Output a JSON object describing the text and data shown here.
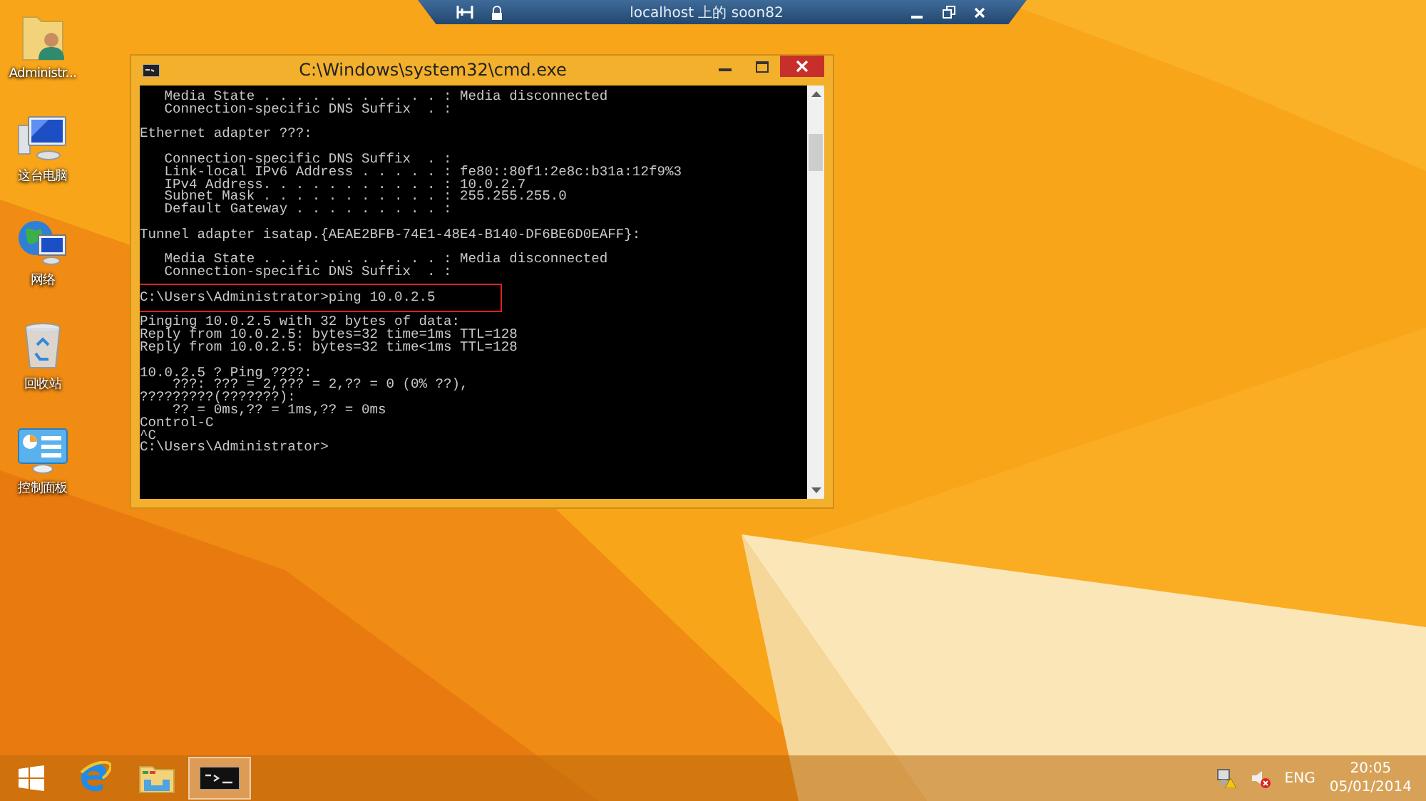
{
  "remote_bar": {
    "title": "localhost 上的 soon82"
  },
  "desktop_icons": [
    {
      "label": "Administr...",
      "kind": "user-folder"
    },
    {
      "label": "这台电脑",
      "kind": "computer"
    },
    {
      "label": "网络",
      "kind": "network"
    },
    {
      "label": "回收站",
      "kind": "recycle-bin"
    },
    {
      "label": "控制面板",
      "kind": "control-panel"
    }
  ],
  "console": {
    "title": "C:\\Windows\\system32\\cmd.exe",
    "blocks": [
      {
        "highlighted": false,
        "lines": [
          "   Media State . . . . . . . . . . . : Media disconnected",
          "   Connection-specific DNS Suffix  . :"
        ]
      },
      {
        "highlighted": false,
        "lines": [
          "Ethernet adapter ???:"
        ]
      },
      {
        "highlighted": false,
        "lines": [
          "   Connection-specific DNS Suffix  . :",
          "   Link-local IPv6 Address . . . . . : fe80::80f1:2e8c:b31a:12f9%3",
          "   IPv4 Address. . . . . . . . . . . : 10.0.2.7",
          "   Subnet Mask . . . . . . . . . . . : 255.255.255.0",
          "   Default Gateway . . . . . . . . . :"
        ]
      },
      {
        "highlighted": false,
        "lines": [
          "Tunnel adapter isatap.{AEAE2BFB-74E1-48E4-B140-DF6BE6D0EAFF}:"
        ]
      },
      {
        "highlighted": false,
        "lines": [
          "   Media State . . . . . . . . . . . : Media disconnected",
          "   Connection-specific DNS Suffix  . :"
        ]
      },
      {
        "highlighted": true,
        "lines": [
          "C:\\Users\\Administrator>ping 10.0.2.5"
        ]
      },
      {
        "highlighted": false,
        "lines": [
          "Pinging 10.0.2.5 with 32 bytes of data:",
          "Reply from 10.0.2.5: bytes=32 time=1ms TTL=128",
          "Reply from 10.0.2.5: bytes=32 time<1ms TTL=128"
        ]
      },
      {
        "highlighted": false,
        "lines": [
          "10.0.2.5 ? Ping ????:",
          "    ???: ??? = 2,??? = 2,?? = 0 (0% ??),",
          "?????????(???????):",
          "    ?? = 0ms,?? = 1ms,?? = 0ms",
          "Control-C",
          "^C",
          "C:\\Users\\Administrator>"
        ]
      }
    ]
  },
  "taskbar": {
    "apps": [
      {
        "kind": "start",
        "active": false
      },
      {
        "kind": "browser",
        "active": false
      },
      {
        "kind": "explorer",
        "active": false
      },
      {
        "kind": "console",
        "active": true
      }
    ],
    "language": "ENG",
    "time": "20:05",
    "date": "05/01/2014"
  }
}
